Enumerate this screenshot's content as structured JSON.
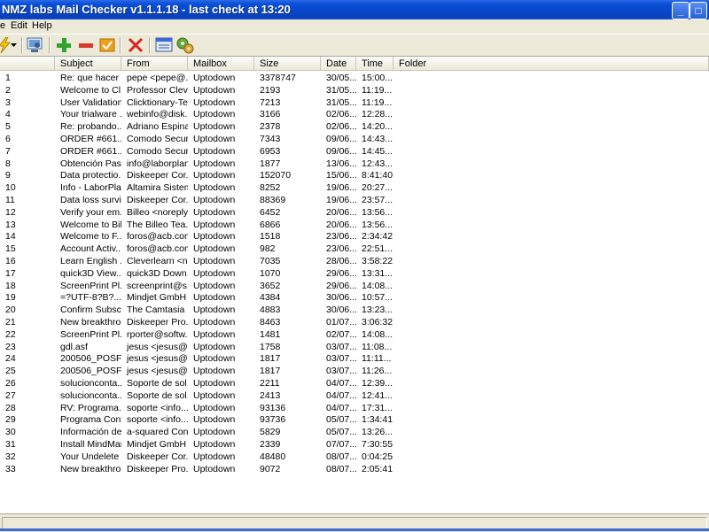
{
  "window": {
    "title": "NMZ labs Mail Checker v1.1.1.18 - last check at 13:20",
    "min_label": "_",
    "max_label": "□",
    "close_label": "✕"
  },
  "menu": {
    "items": [
      {
        "label": "e"
      },
      {
        "label": "Edit"
      },
      {
        "label": "Help"
      }
    ]
  },
  "toolbar": {
    "buttons": [
      {
        "icon": "lightning-icon"
      },
      {
        "icon": "dropdown-arrow-icon"
      },
      {
        "icon": "account-icon"
      },
      {
        "icon": "add-icon"
      },
      {
        "icon": "remove-icon"
      },
      {
        "icon": "check-icon"
      },
      {
        "icon": "delete-icon"
      },
      {
        "icon": "window-icon"
      },
      {
        "icon": "settings-icon"
      }
    ],
    "colors": {
      "add": "#2fa52f",
      "remove": "#d83a2e",
      "check": "#f0a020",
      "delete": "#d8261e"
    }
  },
  "columns": [
    "",
    "Subject",
    "From",
    "Mailbox",
    "Size",
    "Date",
    "Time",
    "Folder"
  ],
  "rows": [
    {
      "n": "1",
      "subject": "Re: que hacer ...",
      "from": "pepe <pepe@...",
      "mailbox": "Uptodown",
      "size": "3378747",
      "date": "30/05...",
      "time": "15:00..."
    },
    {
      "n": "2",
      "subject": "Welcome to Cl...",
      "from": "Professor Clev...",
      "mailbox": "Uptodown",
      "size": "2193",
      "date": "31/05...",
      "time": "11:19..."
    },
    {
      "n": "3",
      "subject": "User Validation...",
      "from": "Clicktionary-Te...",
      "mailbox": "Uptodown",
      "size": "7213",
      "date": "31/05...",
      "time": "11:19..."
    },
    {
      "n": "4",
      "subject": "Your trialware ...",
      "from": "webinfo@disk...",
      "mailbox": "Uptodown",
      "size": "3166",
      "date": "02/06...",
      "time": "12:28..."
    },
    {
      "n": "5",
      "subject": "Re: probando...",
      "from": "Adriano Espina...",
      "mailbox": "Uptodown",
      "size": "2378",
      "date": "02/06...",
      "time": "14:20..."
    },
    {
      "n": "6",
      "subject": "ORDER #661...",
      "from": "Comodo Secur...",
      "mailbox": "Uptodown",
      "size": "7343",
      "date": "09/06...",
      "time": "14:43..."
    },
    {
      "n": "7",
      "subject": "ORDER #661...",
      "from": "Comodo Secur...",
      "mailbox": "Uptodown",
      "size": "6953",
      "date": "09/06...",
      "time": "14:45..."
    },
    {
      "n": "8",
      "subject": "Obtención Pas...",
      "from": "info@laborplan...",
      "mailbox": "Uptodown",
      "size": "1877",
      "date": "13/06...",
      "time": "12:43..."
    },
    {
      "n": "9",
      "subject": "Data protectio...",
      "from": "Diskeeper Cor...",
      "mailbox": "Uptodown",
      "size": "152070",
      "date": "15/06...",
      "time": "8:41:40"
    },
    {
      "n": "10",
      "subject": "Info - LaborPla...",
      "from": "Altamira Sistem...",
      "mailbox": "Uptodown",
      "size": "8252",
      "date": "19/06...",
      "time": "20:27..."
    },
    {
      "n": "11",
      "subject": "Data loss survi...",
      "from": "Diskeeper Cor...",
      "mailbox": "Uptodown",
      "size": "88369",
      "date": "19/06...",
      "time": "23:57..."
    },
    {
      "n": "12",
      "subject": "Verify your em...",
      "from": "Billeo <noreply...",
      "mailbox": "Uptodown",
      "size": "6452",
      "date": "20/06...",
      "time": "13:56..."
    },
    {
      "n": "13",
      "subject": "Welcome to Bil...",
      "from": "The Billeo Tea...",
      "mailbox": "Uptodown",
      "size": "6866",
      "date": "20/06...",
      "time": "13:56..."
    },
    {
      "n": "14",
      "subject": "Welcome to F...",
      "from": "foros@acb.com",
      "mailbox": "Uptodown",
      "size": "1518",
      "date": "23/06...",
      "time": "2:34:42"
    },
    {
      "n": "15",
      "subject": "Account Activ...",
      "from": "foros@acb.com",
      "mailbox": "Uptodown",
      "size": "982",
      "date": "23/06...",
      "time": "22:51..."
    },
    {
      "n": "16",
      "subject": "Learn English ...",
      "from": "Cleverlearn <n...",
      "mailbox": "Uptodown",
      "size": "7035",
      "date": "28/06...",
      "time": "3:58:22"
    },
    {
      "n": "17",
      "subject": "quick3D View...",
      "from": "quick3D Down...",
      "mailbox": "Uptodown",
      "size": "1070",
      "date": "29/06...",
      "time": "13:31..."
    },
    {
      "n": "18",
      "subject": "ScreenPrint Pl...",
      "from": "screenprint@s...",
      "mailbox": "Uptodown",
      "size": "3652",
      "date": "29/06...",
      "time": "14:08..."
    },
    {
      "n": "19",
      "subject": "=?UTF-8?B?...",
      "from": "Mindjet GmbH ...",
      "mailbox": "Uptodown",
      "size": "4384",
      "date": "30/06...",
      "time": "10:57..."
    },
    {
      "n": "20",
      "subject": "Confirm Subscr...",
      "from": "The Camtasia ...",
      "mailbox": "Uptodown",
      "size": "4883",
      "date": "30/06...",
      "time": "13:23..."
    },
    {
      "n": "21",
      "subject": "New breakthro...",
      "from": "Diskeeper Pro...",
      "mailbox": "Uptodown",
      "size": "8463",
      "date": "01/07...",
      "time": "3:06:32"
    },
    {
      "n": "22",
      "subject": "ScreenPrint Pl...",
      "from": "rporter@softw...",
      "mailbox": "Uptodown",
      "size": "1481",
      "date": "02/07...",
      "time": "14:08..."
    },
    {
      "n": "23",
      "subject": "gdl.asf",
      "from": "jesus <jesus@...",
      "mailbox": "Uptodown",
      "size": "1758",
      "date": "03/07...",
      "time": "11:08..."
    },
    {
      "n": "24",
      "subject": "200506_POSF...",
      "from": "jesus <jesus@...",
      "mailbox": "Uptodown",
      "size": "1817",
      "date": "03/07...",
      "time": "11:11..."
    },
    {
      "n": "25",
      "subject": "200506_POSF...",
      "from": "jesus <jesus@...",
      "mailbox": "Uptodown",
      "size": "1817",
      "date": "03/07...",
      "time": "11:26..."
    },
    {
      "n": "26",
      "subject": "solucionconta...",
      "from": "Soporte de sol...",
      "mailbox": "Uptodown",
      "size": "2211",
      "date": "04/07...",
      "time": "12:39..."
    },
    {
      "n": "27",
      "subject": "solucionconta...",
      "from": "Soporte de sol...",
      "mailbox": "Uptodown",
      "size": "2413",
      "date": "04/07...",
      "time": "12:41..."
    },
    {
      "n": "28",
      "subject": "RV:  Programa...",
      "from": "soporte <info...",
      "mailbox": "Uptodown",
      "size": "93136",
      "date": "04/07...",
      "time": "17:31..."
    },
    {
      "n": "29",
      "subject": "Programa Cont...",
      "from": "soporte <info...",
      "mailbox": "Uptodown",
      "size": "93736",
      "date": "05/07...",
      "time": "1:34:41"
    },
    {
      "n": "30",
      "subject": "Información de...",
      "from": "a-squared Con...",
      "mailbox": "Uptodown",
      "size": "5829",
      "date": "05/07...",
      "time": "13:26..."
    },
    {
      "n": "31",
      "subject": "Install MindMan...",
      "from": "Mindjet GmbH ...",
      "mailbox": "Uptodown",
      "size": "2339",
      "date": "07/07...",
      "time": "7:30:55"
    },
    {
      "n": "32",
      "subject": "Your Undelete ...",
      "from": "Diskeeper Cor...",
      "mailbox": "Uptodown",
      "size": "48480",
      "date": "08/07...",
      "time": "0:04:25"
    },
    {
      "n": "33",
      "subject": "New breakthro...",
      "from": "Diskeeper Pro...",
      "mailbox": "Uptodown",
      "size": "9072",
      "date": "08/07...",
      "time": "2:05:41"
    }
  ]
}
